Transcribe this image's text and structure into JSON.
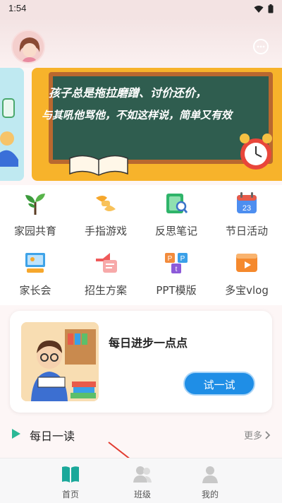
{
  "status_bar": {
    "time": "1:54"
  },
  "banner": {
    "line1": "孩子总是拖拉磨蹭、讨价还价，",
    "line2": "与其吼他骂他，不如这样说，简单又有效"
  },
  "grid": [
    {
      "label": "家园共育",
      "icon": "sapling-icon"
    },
    {
      "label": "手指游戏",
      "icon": "hands-icon"
    },
    {
      "label": "反思笔记",
      "icon": "notebook-search-icon"
    },
    {
      "label": "节日活动",
      "icon": "calendar-icon"
    },
    {
      "label": "家长会",
      "icon": "presentation-icon"
    },
    {
      "label": "招生方案",
      "icon": "megaphone-icon"
    },
    {
      "label": "PPT模版",
      "icon": "ppt-icon"
    },
    {
      "label": "多宝vlog",
      "icon": "video-icon"
    }
  ],
  "daily_card": {
    "title": "每日进步一点点",
    "button": "试一试"
  },
  "daily_read": {
    "title": "每日一读",
    "more": "更多"
  },
  "nav": [
    {
      "label": "首页",
      "icon": "book-icon",
      "active": true
    },
    {
      "label": "班级",
      "icon": "class-icon",
      "active": false
    },
    {
      "label": "我的",
      "icon": "profile-icon",
      "active": false
    }
  ],
  "colors": {
    "accent": "#1f8ee6",
    "banner_bg": "#f7b32b",
    "chalkboard": "#2f5d4f",
    "nav_active": "#1aa89a"
  }
}
